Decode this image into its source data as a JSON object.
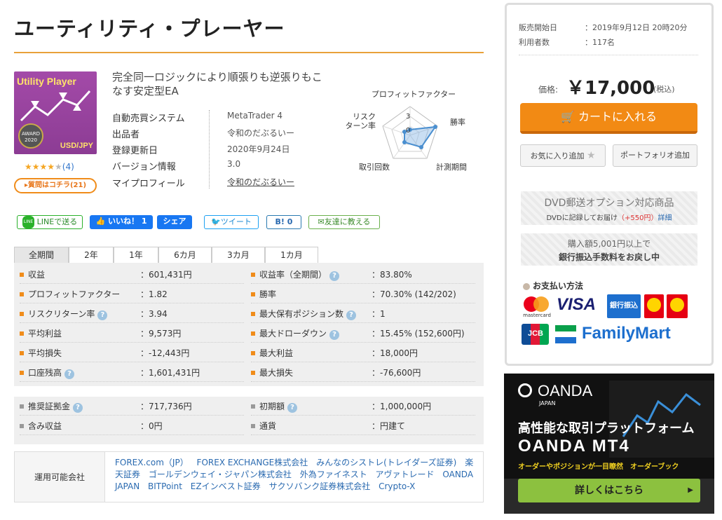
{
  "page": {
    "title": "ユーティリティ・プレーヤー"
  },
  "product": {
    "image_title": "Utility Player",
    "image_pair": "USD/JPY",
    "award_text": "AWARD 2020",
    "stars": "★★★★",
    "stars_empty": "★",
    "review_count": "(4)",
    "ask_button": "▸質問はコチラ(21)",
    "description": "完全同一ロジックにより順張りも逆張りもこなす安定型EA",
    "info": [
      {
        "key": "自動売買システム",
        "value": "MetaTrader 4"
      },
      {
        "key": "出品者",
        "value": "令和のだぶるいー"
      },
      {
        "key": "登録更新日",
        "value": "2020年9月24日"
      },
      {
        "key": "バージョン情報",
        "value": "3.0"
      },
      {
        "key": "マイプロフィール",
        "value": "令和のだぶるいー"
      }
    ]
  },
  "radar": {
    "labels": {
      "pf": "プロフィットファクター",
      "win": "勝率",
      "period": "計測期間",
      "trades": "取引回数",
      "risk": "リスク\nターン率"
    },
    "scale_max": "3",
    "scale_min": "0"
  },
  "social": {
    "line": "LINEで送る",
    "like": "いいね！ 1",
    "share": "シェア",
    "tweet": "ツイート",
    "hatena": "B! 0",
    "friend": "友達に教える"
  },
  "tabs": [
    "全期間",
    "2年",
    "1年",
    "6カ月",
    "3カ月",
    "1カ月"
  ],
  "stats_left": [
    {
      "label": "収益",
      "value": "：601,431円",
      "help": false
    },
    {
      "label": "プロフィットファクター",
      "value": "：1.82",
      "help": false
    },
    {
      "label": "リスクリターン率",
      "value": "：3.94",
      "help": true
    },
    {
      "label": "平均利益",
      "value": "：9,573円",
      "help": false
    },
    {
      "label": "平均損失",
      "value": "：-12,443円",
      "help": false
    },
    {
      "label": "口座残高",
      "value": "：1,601,431円",
      "help": true
    }
  ],
  "stats_right": [
    {
      "label": "収益率（全期間）",
      "value": "：83.80%",
      "help": true
    },
    {
      "label": "勝率",
      "value": "：70.30% (142/202)",
      "help": false
    },
    {
      "label": "最大保有ポジション数",
      "value": "：1",
      "help": true
    },
    {
      "label": "最大ドローダウン",
      "value": "：15.45% (152,600円)",
      "help": true
    },
    {
      "label": "最大利益",
      "value": "：18,000円",
      "help": false
    },
    {
      "label": "最大損失",
      "value": "：-76,600円",
      "help": false
    }
  ],
  "extra_left": [
    {
      "label": "推奨証拠金",
      "value": "：717,736円",
      "help": true
    },
    {
      "label": "含み収益",
      "value": "：0円",
      "help": false
    }
  ],
  "extra_right": [
    {
      "label": "初期額",
      "value": "：1,000,000円",
      "help": true
    },
    {
      "label": "通貨",
      "value": "：円建て",
      "help": false
    }
  ],
  "brokers": {
    "label": "運用可能会社",
    "list": [
      "FOREX.com（JP）",
      "FOREX EXCHANGE株式会社",
      "みんなのシストレ(トレイダーズ証券)",
      "楽天証券",
      "ゴールデンウェイ・ジャパン株式会社",
      "外為ファイネスト",
      "アヴァトレード",
      "OANDA JAPAN",
      "BITPoint",
      "EZインベスト証券",
      "サクソバンク証券株式会社",
      "Crypto-X"
    ]
  },
  "sale": {
    "start_label": "販売開始日",
    "start_value": "：2019年9月12日 20時20分",
    "users_label": "利用者数",
    "users_value": "：117名",
    "price_label": "価格:",
    "price": "￥17,000",
    "tax": "(税込)",
    "cart_button": "カートに入れる",
    "fav_button": "お気に入り追加",
    "portfolio_button": "ポートフォリオ追加",
    "dvd_title": "DVD郵送オプション対応商品",
    "dvd_sub": "DVDに記録してお届け",
    "dvd_price": "（+550円）",
    "dvd_link": "詳細",
    "bank_line1": "購入額5,001円以上で",
    "bank_line2": "銀行振込手数料をお戻し中",
    "pay_title": "お支払い方法",
    "pay_logos": {
      "visa": "VISA",
      "bank": "銀行振込",
      "mc": "mastercard",
      "jcb": "JCB",
      "familymart": "FamilyMart"
    }
  },
  "ad": {
    "brand": "OANDA",
    "brand_sub": "JAPAN",
    "headline": "高性能な取引プラットフォーム",
    "product": "OANDA MT4",
    "tagline": "オーダーやポジションが一目瞭然　オーダーブック",
    "button": "詳しくはこちら"
  },
  "colors": {
    "accent": "#f28a14",
    "link": "#2a6ab0",
    "title_line": "#e8a13a"
  }
}
